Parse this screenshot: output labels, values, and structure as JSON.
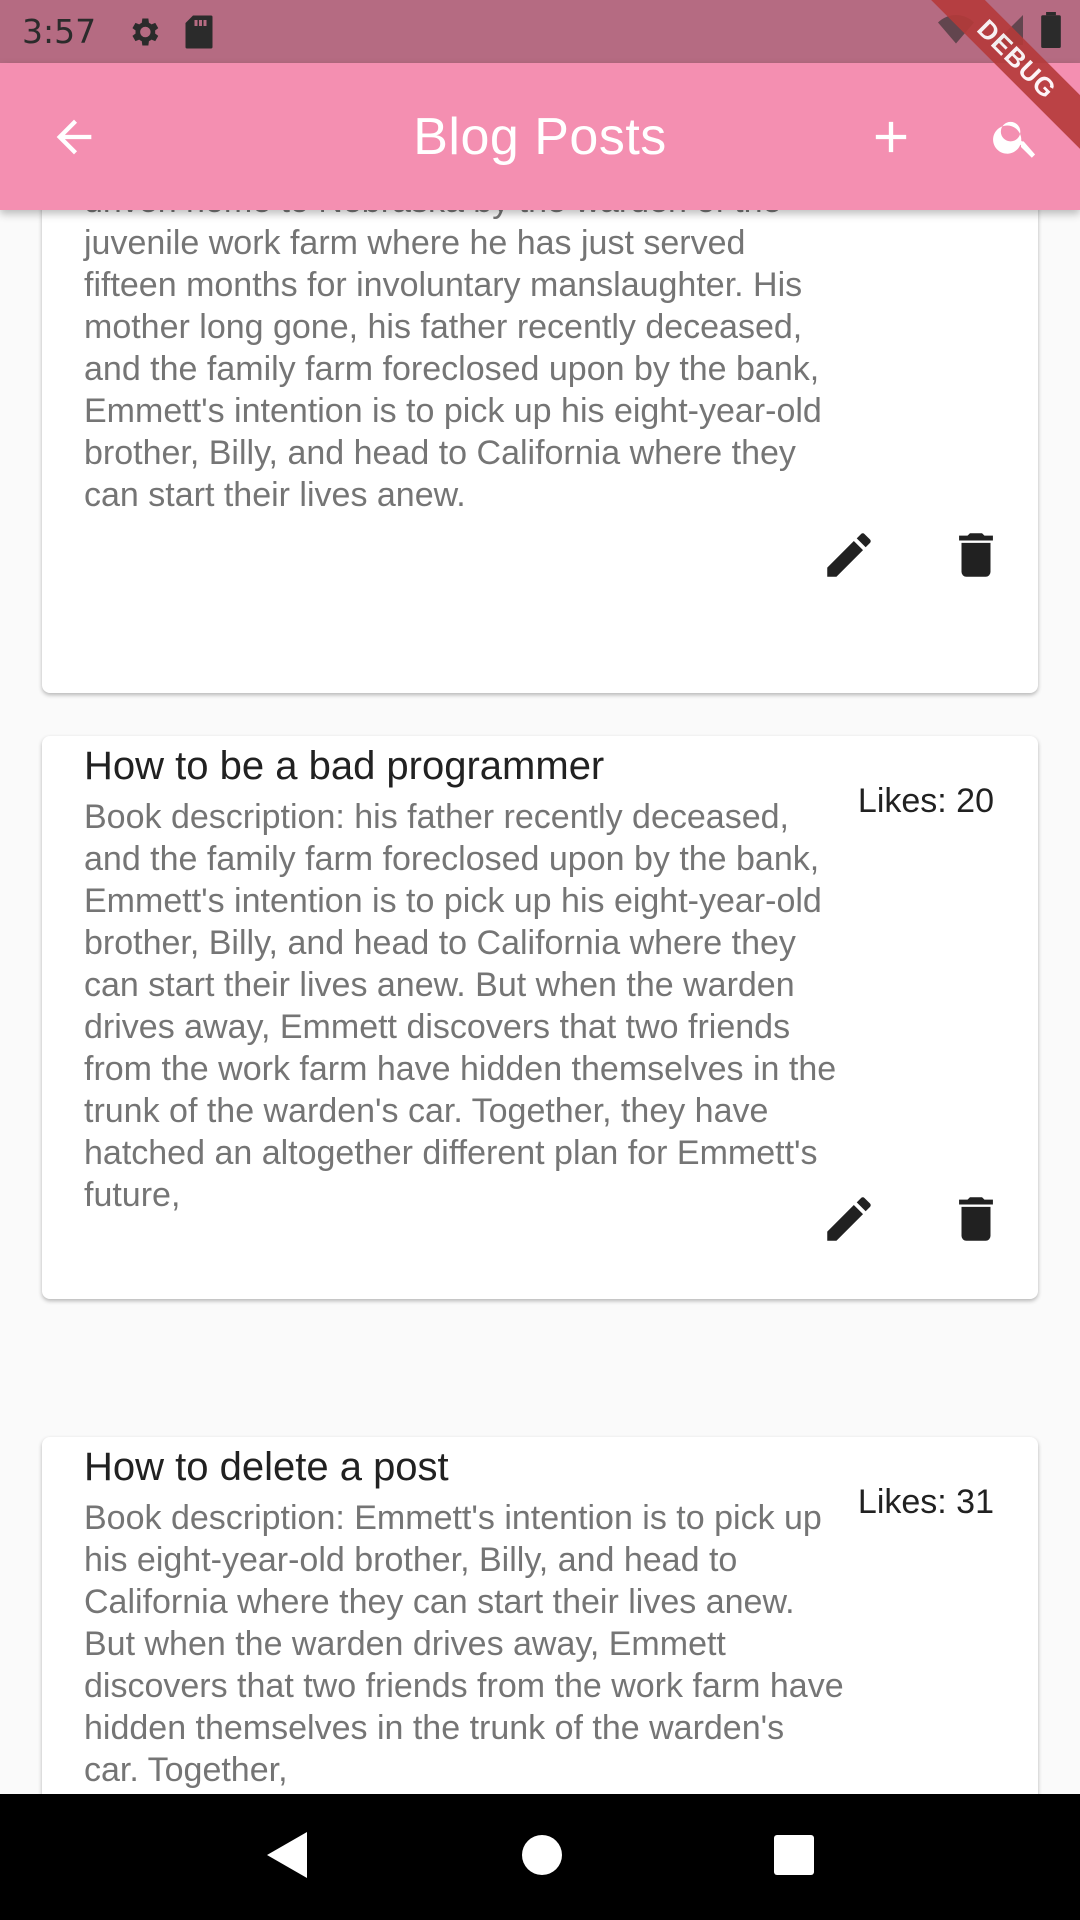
{
  "status_bar": {
    "time": "3:57",
    "icons": [
      "settings-icon",
      "sd-card-icon",
      "wifi-icon",
      "signal-icon",
      "battery-icon"
    ]
  },
  "app_bar": {
    "title": "Blog Posts",
    "back_icon": "arrow-back-icon",
    "add_icon": "add-icon",
    "search_icon": "search-icon",
    "background": "#f48fb1"
  },
  "debug_banner": "DEBUG",
  "posts": [
    {
      "title": "",
      "likes": "",
      "description": "driven home to Nebraska by the warden of the juvenile work farm where he has just served fifteen months for involuntary manslaughter. His mother long gone, his father recently deceased, and the family farm foreclosed upon by the bank, Emmett's intention is to pick up his eight-year-old brother, Billy, and head to California where they can start their lives anew."
    },
    {
      "title": "How to be a bad programmer",
      "likes": "Likes: 20",
      "description": "Book description:  his father recently deceased, and the family farm foreclosed upon by the bank, Emmett's intention is to pick up his eight-year-old brother, Billy, and head to California where they can start their lives anew. But when the warden drives away, Emmett discovers that two friends from the work farm have hidden themselves in the trunk of the warden's car. Together, they have hatched an altogether different plan for Emmett's future,"
    },
    {
      "title": "How to delete a post",
      "likes": "Likes: 31",
      "description": "Book description: Emmett's intention is to pick up his eight-year-old brother, Billy, and head to California where they can start their lives anew. But when the warden drives away, Emmett discovers that two friends from the work farm have hidden themselves in the trunk of the warden's car. Together,"
    }
  ],
  "post_actions": {
    "edit_icon": "edit-icon",
    "delete_icon": "delete-icon"
  },
  "nav_bar": {
    "icons": [
      "back-triangle-icon",
      "home-circle-icon",
      "recents-square-icon"
    ]
  }
}
